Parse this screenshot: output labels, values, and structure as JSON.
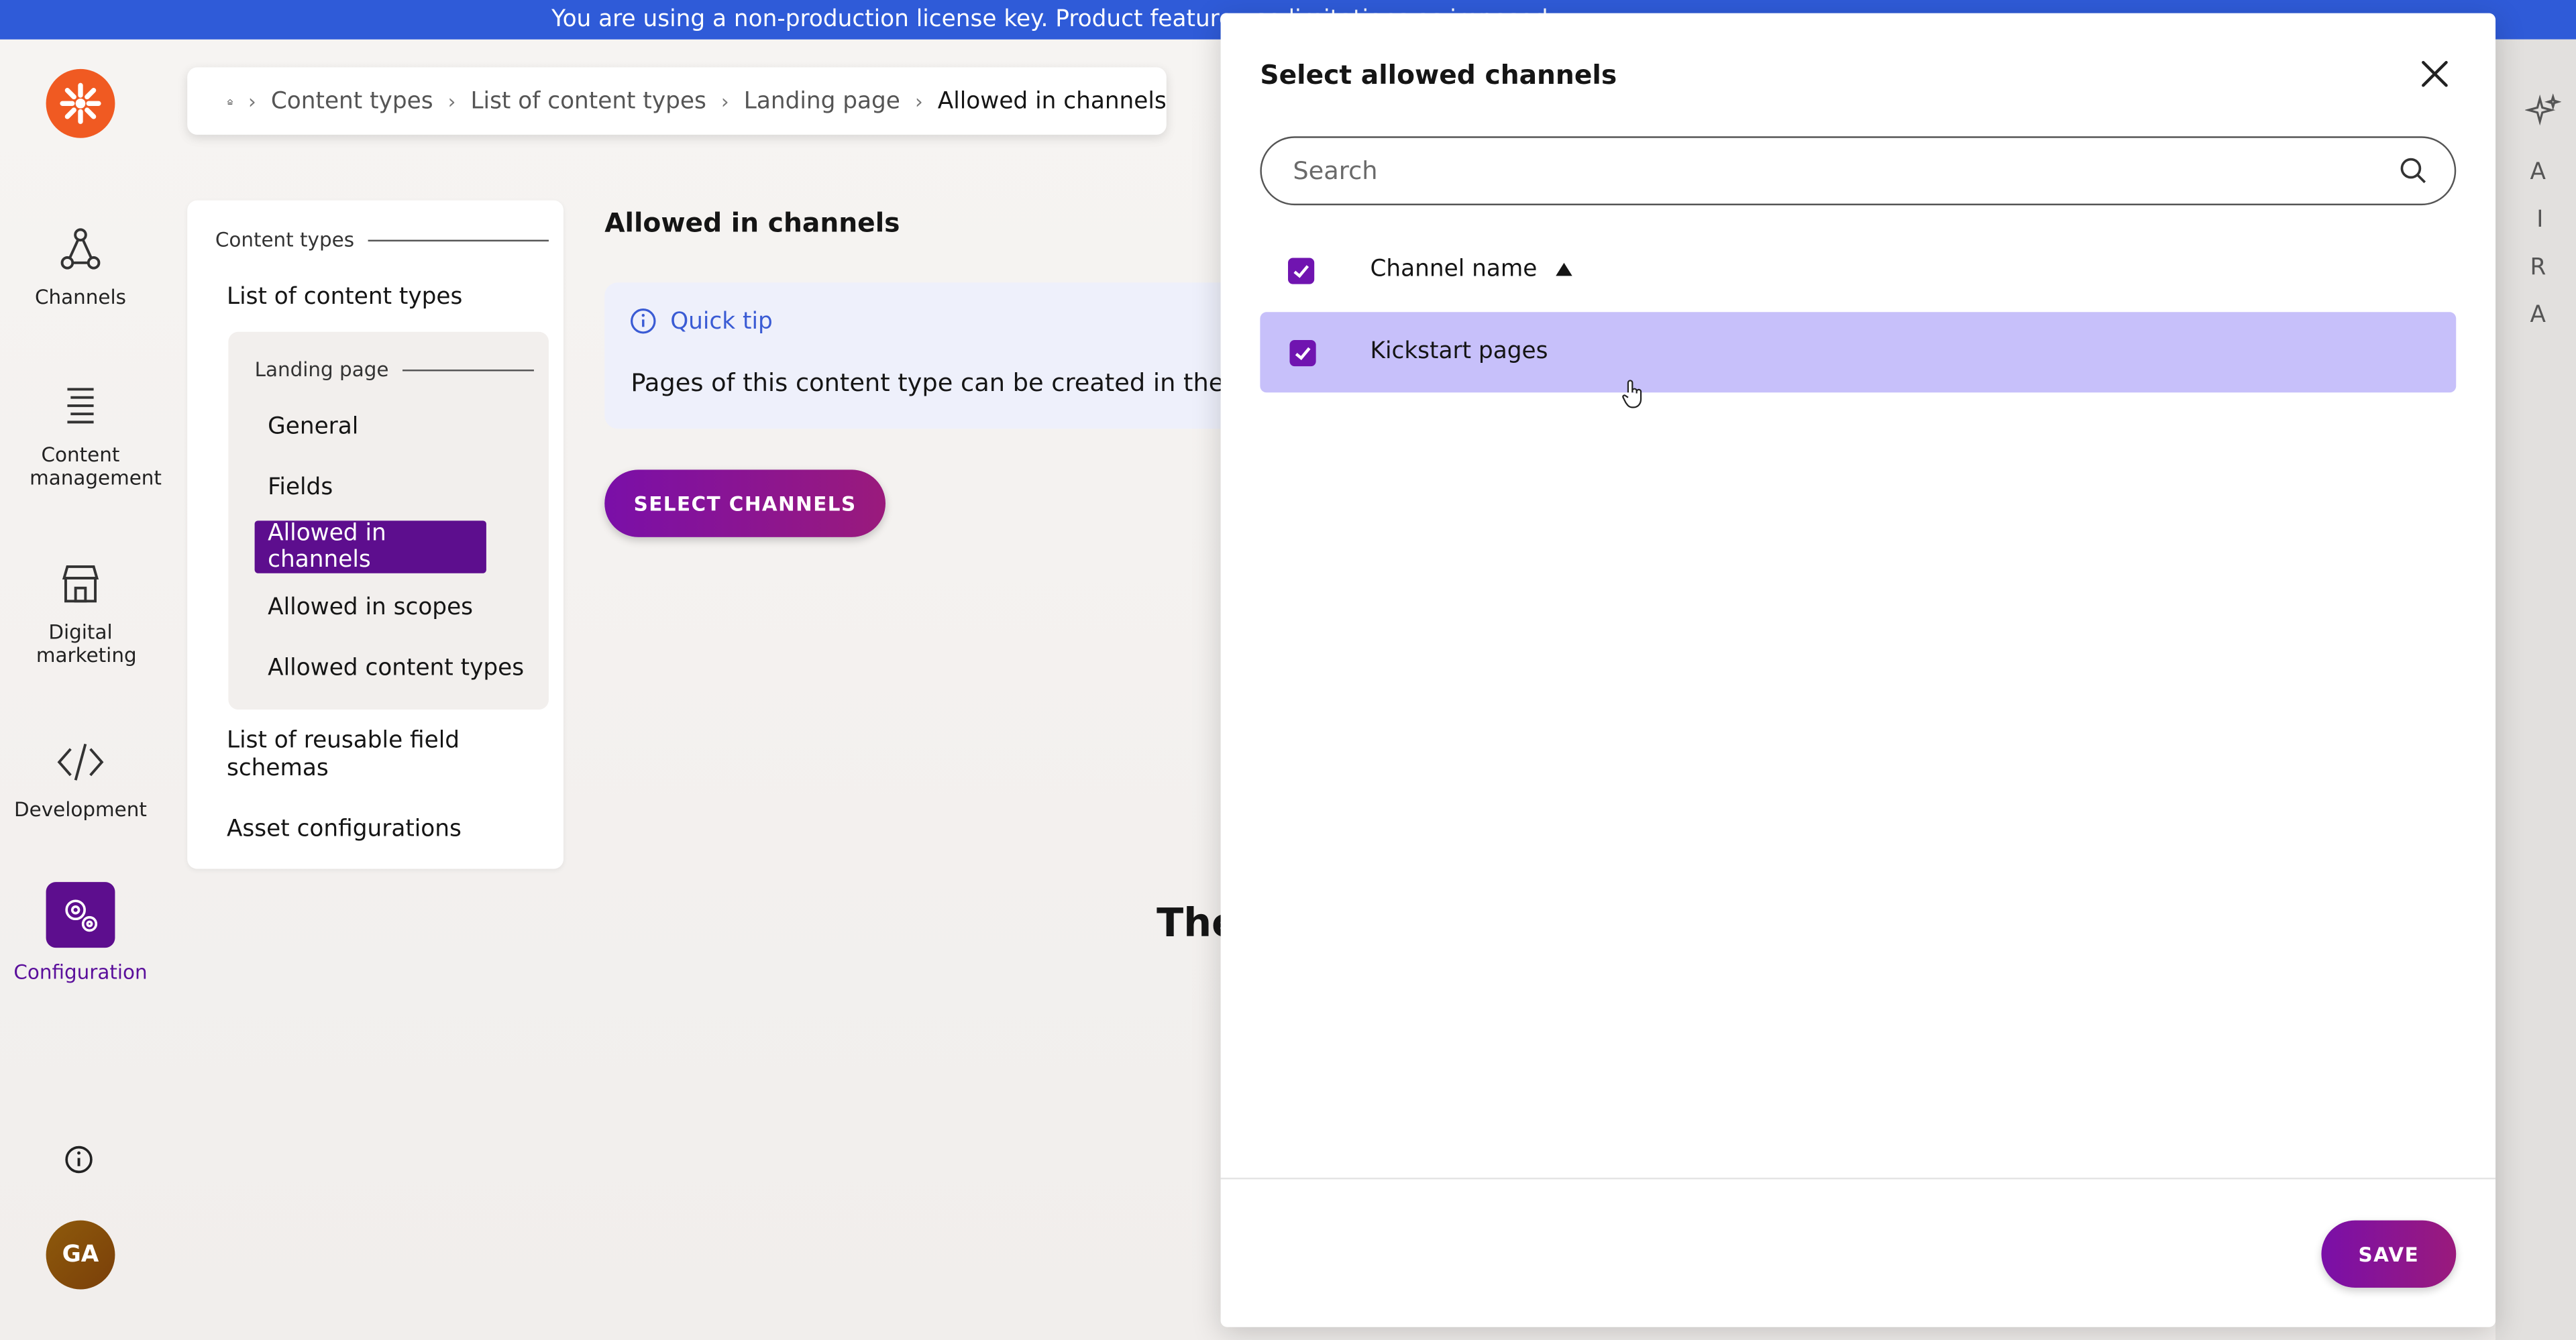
{
  "banner": {
    "text": "You are using a non-production license key. Product feature use limitations as imposed"
  },
  "nav": {
    "items": [
      {
        "label": "Channels",
        "icon": "channels-icon"
      },
      {
        "label": "Content management",
        "icon": "content-management-icon"
      },
      {
        "label": "Digital marketing",
        "icon": "digital-marketing-icon"
      },
      {
        "label": "Development",
        "icon": "development-icon"
      },
      {
        "label": "Configuration",
        "icon": "gear-icon",
        "active": true
      }
    ],
    "avatar": "GA"
  },
  "breadcrumb": [
    "Content types",
    "List of content types",
    "Landing page",
    "Allowed in channels"
  ],
  "side": {
    "section_title": "Content types",
    "list_item": "List of content types",
    "sub_title": "Landing page",
    "sub_items": [
      "General",
      "Fields",
      "Allowed in channels",
      "Allowed in scopes",
      "Allowed content types"
    ],
    "bottom_items": [
      "List of reusable field schemas",
      "Asset configurations"
    ]
  },
  "content": {
    "title": "Allowed in channels",
    "tip_title": "Quick tip",
    "tip_text": "Pages of this content type can be created in the f",
    "select_button": "SELECT CHANNELS",
    "bg_text": "The"
  },
  "right_strip": {
    "letters": [
      "A",
      "I",
      "R",
      "A"
    ]
  },
  "dialog": {
    "title": "Select allowed channels",
    "search_placeholder": "Search",
    "column_header": "Channel name",
    "rows": [
      {
        "name": "Kickstart pages",
        "checked": true
      }
    ],
    "save_button": "SAVE"
  },
  "colors": {
    "accent": "#5d0e8e",
    "banner": "#2f5bd8",
    "row_selected": "#c7c0fa",
    "logo": "#f05a22"
  }
}
